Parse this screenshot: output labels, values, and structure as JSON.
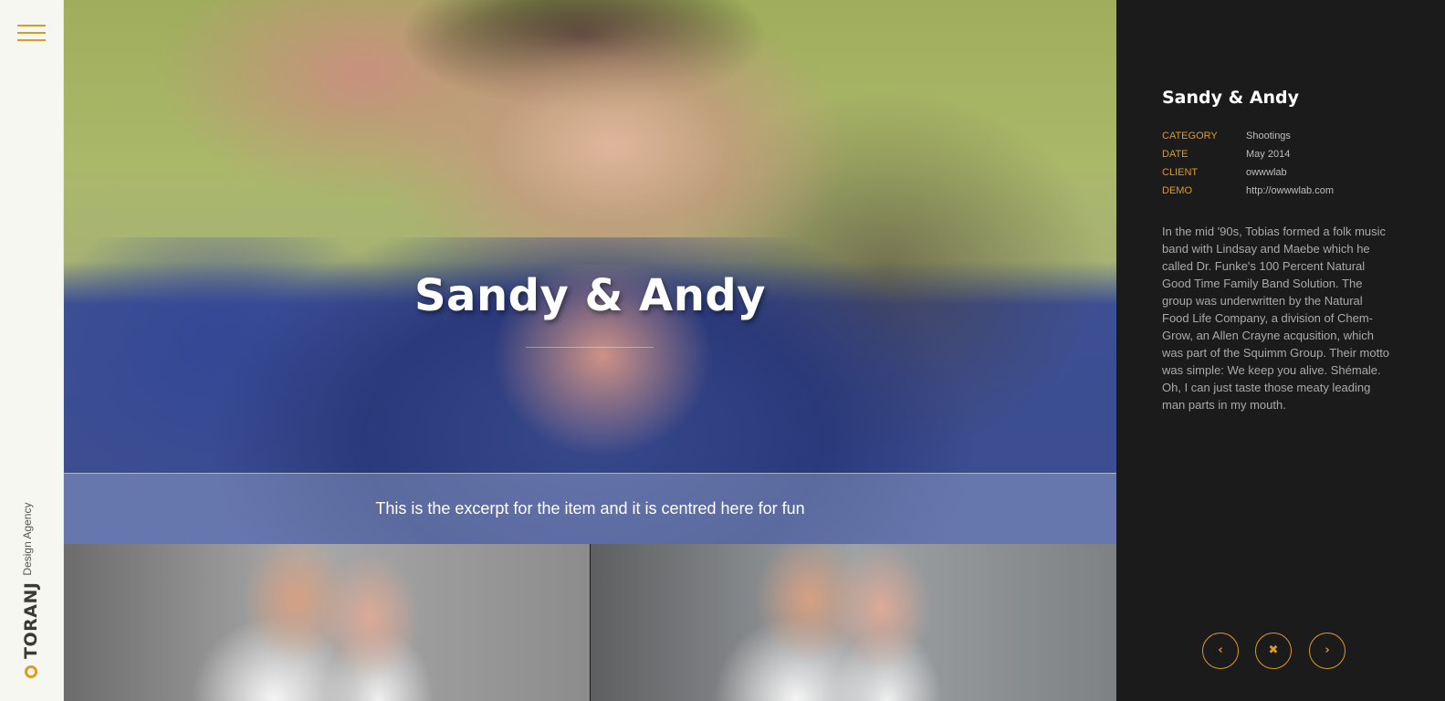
{
  "sidebar": {
    "menu_icon": "hamburger-icon",
    "brand_mark_icon": "ring-logo-icon",
    "brand_name": "TORANJ",
    "brand_tagline": "Design Agency"
  },
  "hero": {
    "title": "Sandy & Andy",
    "excerpt": "This is the excerpt for the item and it is centred here for fun"
  },
  "project": {
    "title": "Sandy & Andy",
    "meta": [
      {
        "key": "CATEGORY",
        "value": "Shootings"
      },
      {
        "key": "DATE",
        "value": "May 2014"
      },
      {
        "key": "CLIENT",
        "value": "owwwlab"
      },
      {
        "key": "DEMO",
        "value": "http://owwwlab.com"
      }
    ],
    "description": "In the mid '90s, Tobias formed a folk music band with Lindsay and Maebe which he called Dr. Funke's 100 Percent Natural Good Time Family Band Solution. The group was underwritten by the Natural Food Life Company, a division of Chem-Grow, an Allen Crayne acqusition, which was part of the Squimm Group. Their motto was simple: We keep you alive. Shémale. Oh, I can just taste those meaty leading man parts in my mouth."
  },
  "nav": {
    "prev_glyph": "‹",
    "close_glyph": "✖",
    "next_glyph": "›"
  },
  "colors": {
    "accent": "#e09a1f",
    "panel_bg": "#1b1b1b",
    "rail_bg": "#f7f7f2"
  }
}
